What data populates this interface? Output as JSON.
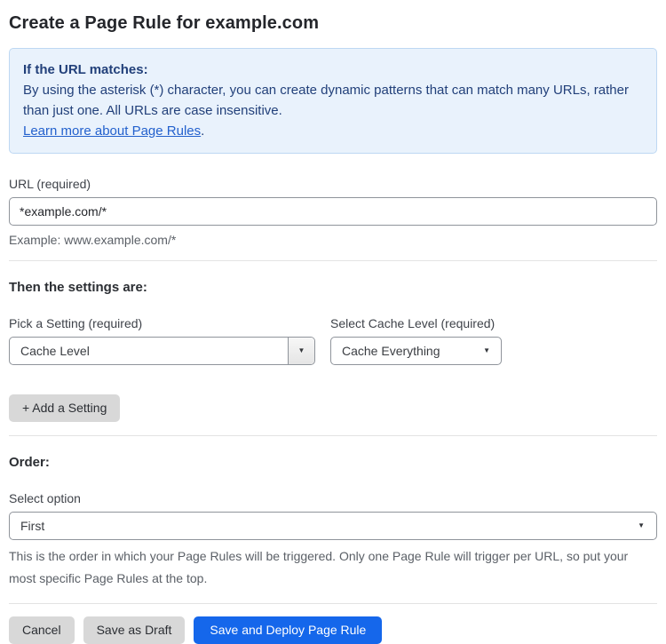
{
  "page": {
    "title": "Create a Page Rule for example.com"
  },
  "info_box": {
    "heading": "If the URL matches:",
    "body": "By using the asterisk (*) character, you can create dynamic patterns that can match many URLs, rather than just one. All URLs are case insensitive.",
    "link_label": "Learn more about Page Rules",
    "link_suffix": "."
  },
  "url_field": {
    "label": "URL (required)",
    "value": "*example.com/*",
    "hint": "Example: www.example.com/*"
  },
  "settings_section": {
    "heading": "Then the settings are:",
    "setting_picker": {
      "label": "Pick a Setting (required)",
      "value": "Cache Level"
    },
    "cache_level_picker": {
      "label": "Select Cache Level (required)",
      "value": "Cache Everything"
    },
    "add_setting_label": "+ Add a Setting"
  },
  "order_section": {
    "heading": "Order:",
    "label": "Select option",
    "value": "First",
    "hint": "This is the order in which your Page Rules will be triggered. Only one Page Rule will trigger per URL, so put your most specific Page Rules at the top."
  },
  "footer": {
    "cancel_label": "Cancel",
    "save_draft_label": "Save as Draft",
    "save_deploy_label": "Save and Deploy Page Rule"
  },
  "icons": {
    "dropdown_arrow": "▼"
  },
  "colors": {
    "accent_blue": "#1567eb",
    "button_gray": "#d8d8d8",
    "info_bg": "#e9f2fc",
    "info_border": "#bed8f3",
    "info_text": "#22407a",
    "link_blue": "#2361cd"
  }
}
